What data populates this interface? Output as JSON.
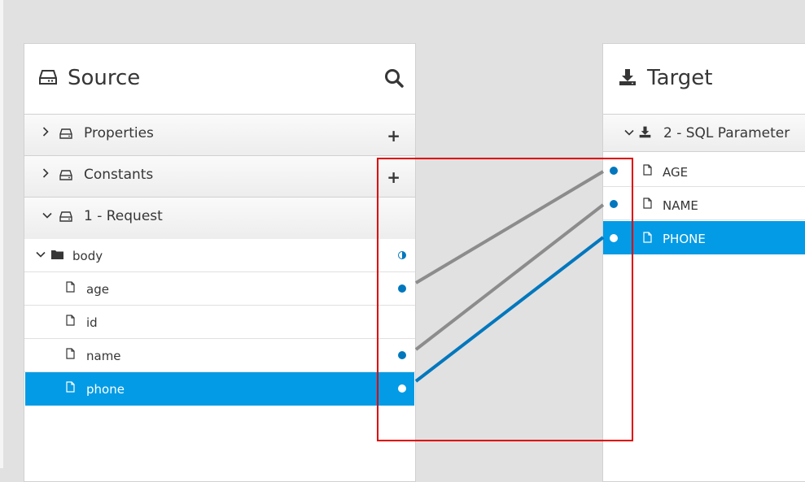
{
  "source": {
    "title": "Source",
    "documents": [
      {
        "label": "Properties",
        "expanded": false
      },
      {
        "label": "Constants",
        "expanded": false
      },
      {
        "label": "1 - Request",
        "expanded": true
      }
    ],
    "fields": [
      {
        "label": "body",
        "type": "folder",
        "mapping": "partial"
      },
      {
        "label": "age",
        "type": "file",
        "mapping": "mapped"
      },
      {
        "label": "id",
        "type": "file",
        "mapping": "none"
      },
      {
        "label": "name",
        "type": "file",
        "mapping": "mapped"
      },
      {
        "label": "phone",
        "type": "file",
        "mapping": "mapped",
        "selected": true
      }
    ]
  },
  "target": {
    "title": "Target",
    "document": {
      "label": "2 - SQL Parameter",
      "expanded": true
    },
    "fields": [
      {
        "label": "AGE",
        "mapping": "mapped"
      },
      {
        "label": "NAME",
        "mapping": "mapped"
      },
      {
        "label": "PHONE",
        "mapping": "mapped",
        "selected": true
      }
    ]
  },
  "mappings": [
    {
      "source": "age",
      "target": "AGE",
      "selected": false
    },
    {
      "source": "name",
      "target": "NAME",
      "selected": false
    },
    {
      "source": "phone",
      "target": "PHONE",
      "selected": true
    }
  ],
  "colors": {
    "selection": "#039be5",
    "mapped_dot": "#0277bd",
    "line": "#8c8c8c",
    "line_selected": "#0277bd",
    "annotation": "#dd0000"
  }
}
